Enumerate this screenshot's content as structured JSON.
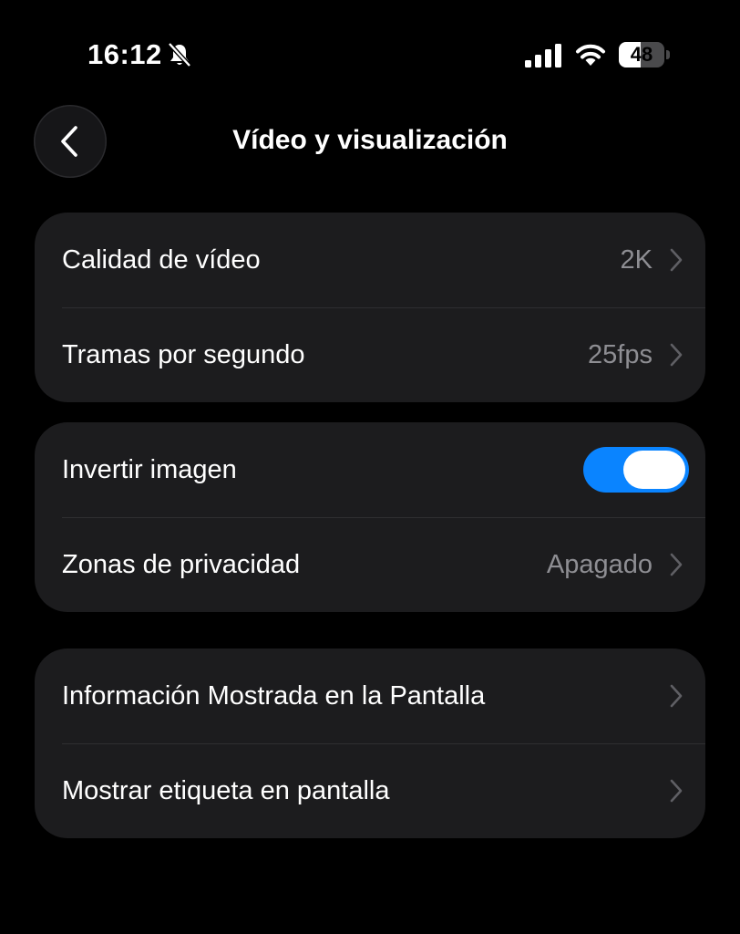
{
  "status_bar": {
    "time": "16:12",
    "battery_level": "48",
    "battery_fraction": 0.48,
    "icons": [
      "bell-slash-icon",
      "cellular-signal-icon",
      "wifi-icon",
      "battery-icon"
    ]
  },
  "header": {
    "title": "Vídeo y visualización",
    "back_icon": "chevron-left-icon"
  },
  "groups": [
    {
      "rows": [
        {
          "label": "Calidad de vídeo",
          "value": "2K",
          "type": "navigation"
        },
        {
          "label": "Tramas por segundo",
          "value": "25fps",
          "type": "navigation"
        }
      ]
    },
    {
      "rows": [
        {
          "label": "Invertir imagen",
          "type": "toggle",
          "on": true
        },
        {
          "label": "Zonas de privacidad",
          "value": "Apagado",
          "type": "navigation"
        }
      ]
    },
    {
      "rows": [
        {
          "label": "Información Mostrada en la Pantalla",
          "type": "navigation"
        },
        {
          "label": "Mostrar etiqueta en pantalla",
          "type": "navigation"
        }
      ]
    }
  ],
  "colors": {
    "background": "#000000",
    "card": "#1c1c1e",
    "secondary_text": "#8e8e93",
    "toggle_on": "#0a84ff"
  }
}
